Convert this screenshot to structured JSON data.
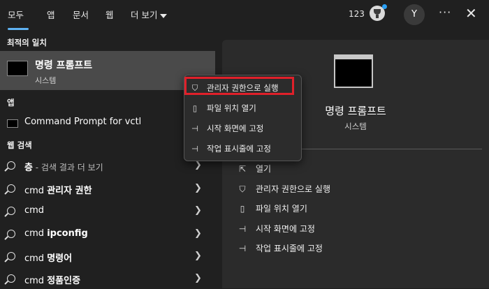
{
  "tabs": [
    "모두",
    "앱",
    "문서",
    "웹",
    "더 보기"
  ],
  "header": {
    "points": "123",
    "avatar_initial": "Y",
    "more": "···",
    "close": "✕"
  },
  "sections": {
    "best_match": "최적의 일치",
    "apps": "앱",
    "web": "웹 검색"
  },
  "best_match": {
    "title": "명령 프롬프트",
    "subtitle": "시스템"
  },
  "apps": [
    {
      "label": "Command Prompt for vctl"
    }
  ],
  "web_results": [
    {
      "bold": "층",
      "dim": " - 검색 결과 더 보기"
    },
    {
      "pre": "cmd ",
      "bold": "관리자 권한"
    },
    {
      "pre": "cmd",
      "bold": ""
    },
    {
      "pre": "cmd ",
      "bold": "ipconfig"
    },
    {
      "pre": "cmd ",
      "bold": "명령어"
    },
    {
      "pre": "cmd ",
      "bold": "정품인증"
    }
  ],
  "context_menu": [
    {
      "label": "관리자 권한으로 실행",
      "icon": "shield-icon"
    },
    {
      "label": "파일 위치 열기",
      "icon": "folder-icon"
    },
    {
      "label": "시작 화면에 고정",
      "icon": "pin-icon"
    },
    {
      "label": "작업 표시줄에 고정",
      "icon": "pin-icon"
    }
  ],
  "detail": {
    "title": "명령 프롬프트",
    "subtitle": "시스템",
    "actions": [
      {
        "label": "열기",
        "icon": "open-icon"
      },
      {
        "label": "관리자 권한으로 실행",
        "icon": "shield-icon"
      },
      {
        "label": "파일 위치 열기",
        "icon": "folder-icon"
      },
      {
        "label": "시작 화면에 고정",
        "icon": "pin-icon"
      },
      {
        "label": "작업 표시줄에 고정",
        "icon": "pin-icon"
      }
    ]
  },
  "colors": {
    "background": "#202020",
    "accent": "#5fb2f2",
    "selected_row": "#4a4a4a",
    "highlight_box": "#e0202a",
    "badge": "#2aa0f5"
  }
}
